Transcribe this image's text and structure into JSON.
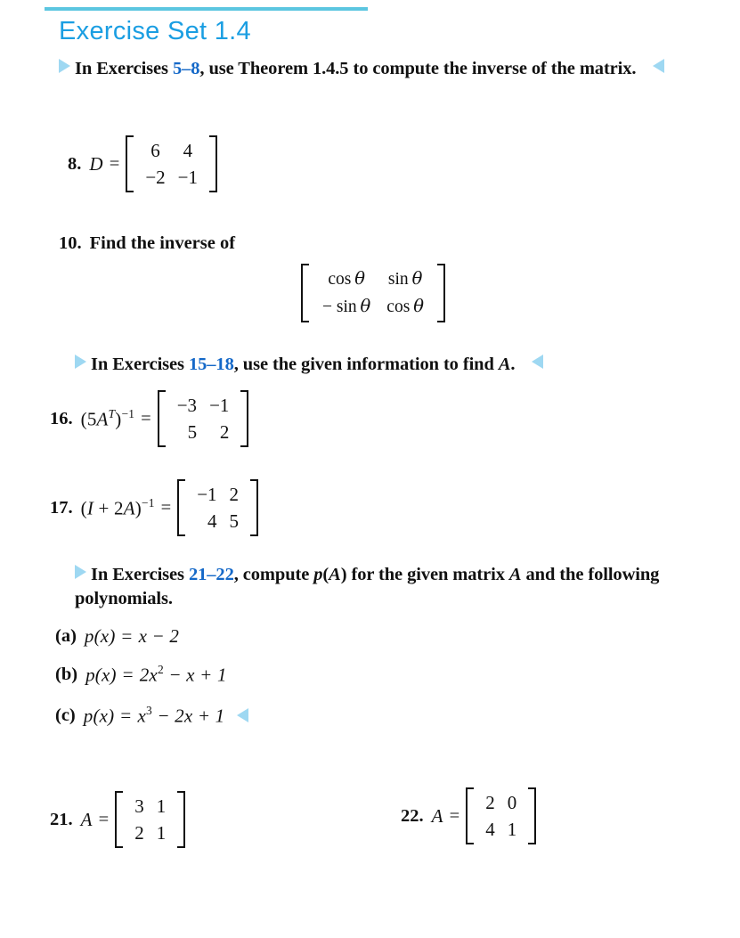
{
  "header": {
    "title": "Exercise Set 1.4",
    "rule_color": "#5cc6e0",
    "title_color": "#1a9ee2"
  },
  "colors": {
    "reference_blue": "#1468c8",
    "triangle_blue": "#9ed8f2",
    "text": "#111111",
    "background": "#ffffff"
  },
  "sections": [
    {
      "id": "intro-5-8",
      "lead_in": "In Exercises ",
      "range": "5–8",
      "rest": ", use Theorem 1.4.5 to compute the inverse of the matrix."
    },
    {
      "id": "intro-15-18",
      "lead_in": "In Exercises ",
      "range": "15–18",
      "rest": ", use the given information to find ",
      "italic_symbol": "A",
      "terminator": "."
    },
    {
      "id": "intro-21-22",
      "lead_in": "In Exercises ",
      "range": "21–22",
      "rest_a": ", compute ",
      "italic_p": "p",
      "paren_a": "(",
      "italic_A": "A",
      "paren_b": ")",
      "rest_b": " for the given matrix ",
      "italic_A2": "A",
      "rest_c": " and the following polynomials."
    }
  ],
  "problems": {
    "p8": {
      "number": "8.",
      "label": "D",
      "equals": "=",
      "matrix": [
        [
          "6",
          "4"
        ],
        [
          "−2",
          "−1"
        ]
      ]
    },
    "p10": {
      "number": "10.",
      "text": "Find the inverse of",
      "matrix": [
        [
          "cos",
          "sin"
        ],
        [
          "− sin",
          "cos"
        ]
      ],
      "theta": "θ"
    },
    "p16": {
      "number": "16.",
      "expr_open": "(5",
      "expr_A": "A",
      "expr_T": "T",
      "expr_close": ")",
      "expr_inv": "−1",
      "equals": "=",
      "matrix": [
        [
          "−3",
          "−1"
        ],
        [
          "5",
          "2"
        ]
      ]
    },
    "p17": {
      "number": "17.",
      "expr_I": "I",
      "expr_plus": " + 2",
      "expr_A": "A",
      "expr_open": "(",
      "expr_close": ")",
      "expr_inv": "−1",
      "equals": "=",
      "matrix": [
        [
          "−1",
          "2"
        ],
        [
          "4",
          "5"
        ]
      ]
    },
    "p21": {
      "number": "21.",
      "label": "A",
      "equals": "=",
      "matrix": [
        [
          "3",
          "1"
        ],
        [
          "2",
          "1"
        ]
      ]
    },
    "p22": {
      "number": "22.",
      "label": "A",
      "equals": "=",
      "matrix": [
        [
          "2",
          "0"
        ],
        [
          "4",
          "1"
        ]
      ]
    }
  },
  "polynomials": [
    {
      "tag": "(a)",
      "fn": "p",
      "arg": "(x)",
      "equals": "=",
      "body_pre": "x − 2",
      "body_html": "x − 2"
    },
    {
      "tag": "(b)",
      "fn": "p",
      "arg": "(x)",
      "equals": "=",
      "body_pre": "2x",
      "exponent": "2",
      "body_post": " − x + 1"
    },
    {
      "tag": "(c)",
      "fn": "p",
      "arg": "(x)",
      "equals": "=",
      "body_pre": "x",
      "exponent": "3",
      "body_post": " − 2x + 1"
    }
  ],
  "icons": {
    "section_start": "triangle-right-icon",
    "section_end": "triangle-left-icon"
  }
}
